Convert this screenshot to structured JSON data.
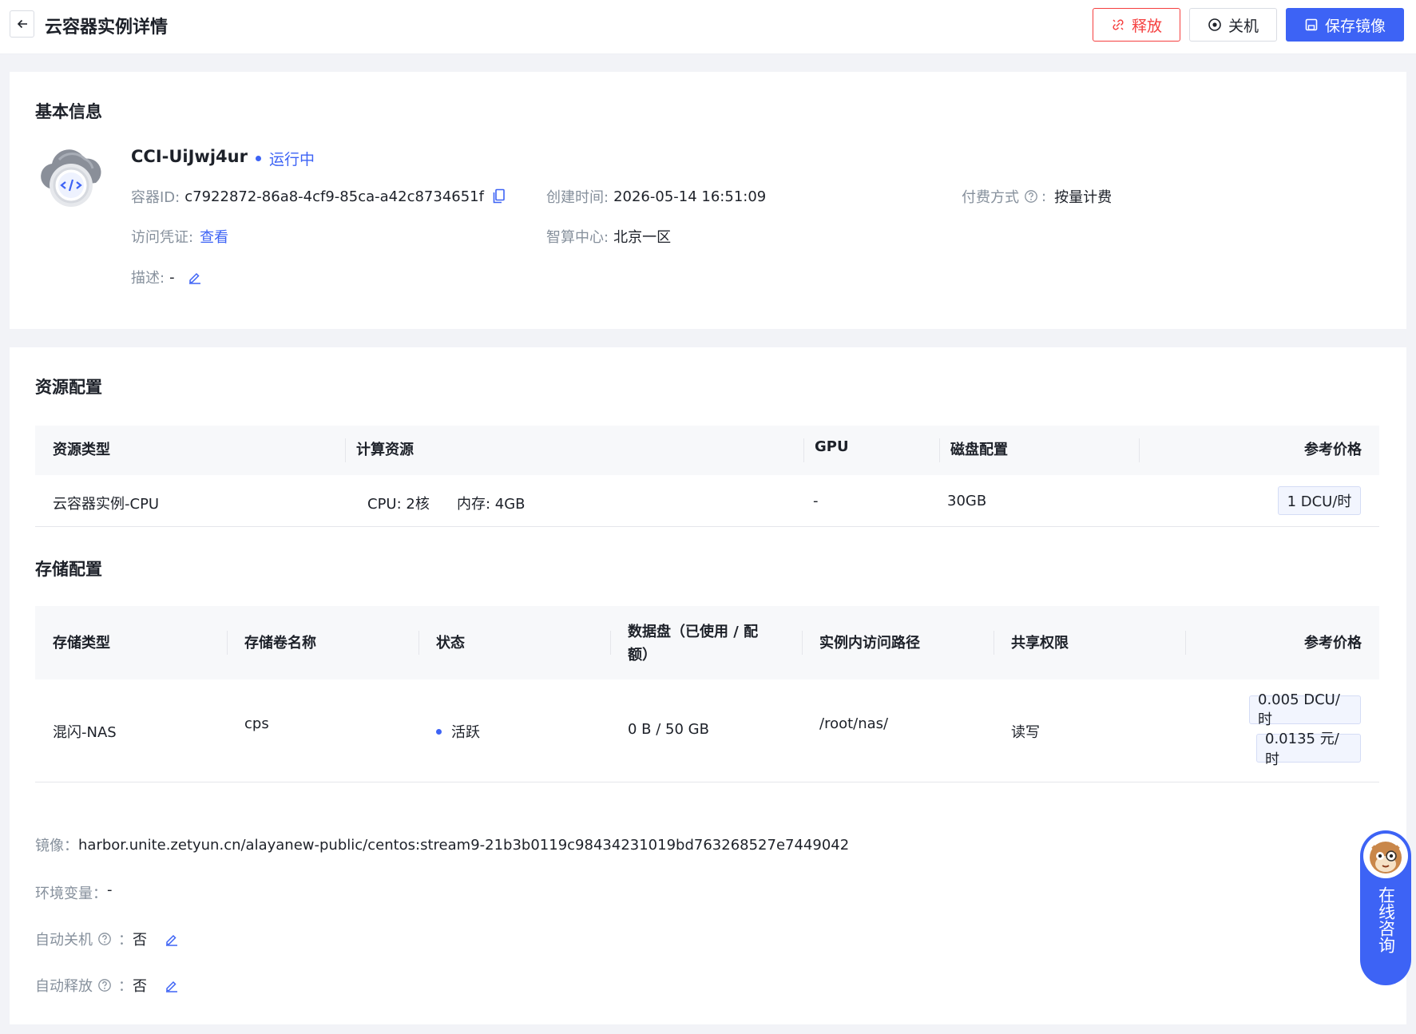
{
  "header": {
    "title": "云容器实例详情",
    "release_label": "释放",
    "shutdown_label": "关机",
    "save_image_label": "保存镜像"
  },
  "basic": {
    "section_title": "基本信息",
    "instance_name": "CCI-UiJwj4ur",
    "status": "运行中",
    "container_id_label": "容器ID:",
    "container_id": "c7922872-86a8-4cf9-85ca-a42c8734651f",
    "created_label": "创建时间:",
    "created_at": "2026-05-14 16:51:09",
    "billing_label": "付费方式",
    "billing_colon": ":",
    "billing_value": "按量计费",
    "credential_label": "访问凭证:",
    "credential_link": "查看",
    "center_label": "智算中心:",
    "center_value": "北京一区",
    "desc_label": "描述:",
    "desc_value": "-"
  },
  "resource": {
    "section_title": "资源配置",
    "headers": [
      "资源类型",
      "计算资源",
      "GPU",
      "磁盘配置",
      "参考价格"
    ],
    "row": {
      "type": "云容器实例-CPU",
      "cpu": "CPU:  2核",
      "mem": "内存:  4GB",
      "gpu": "-",
      "disk": "30GB",
      "price": "1 DCU/时"
    }
  },
  "storage": {
    "section_title": "存储配置",
    "headers": [
      "存储类型",
      "存储卷名称",
      "状态",
      "数据盘（已使用 / 配",
      "额）",
      "实例内访问路径",
      "共享权限",
      "参考价格"
    ],
    "row": {
      "type": "混闪-NAS",
      "name": "cps",
      "status": "活跃",
      "usage": "0 B / 50 GB",
      "path": "/root/nas/",
      "permission": "读写",
      "price_dcu": "0.005 DCU/时",
      "price_cny": "0.0135 元/时"
    }
  },
  "extra": {
    "image_label": "镜像：",
    "image_value": "harbor.unite.zetyun.cn/alayanew-public/centos:stream9-21b3b0119c98434231019bd763268527e7449042",
    "env_label": "环境变量：",
    "env_value": "-",
    "auto_shutdown_label": "自动关机",
    "auto_shutdown_value": "否",
    "auto_release_label": "自动释放",
    "auto_release_value": "否",
    "colon": "："
  },
  "consult": {
    "label": "在线咨询"
  },
  "colors": {
    "primary": "#3d63f5",
    "danger": "#f53f3f",
    "muted": "#86909c"
  }
}
